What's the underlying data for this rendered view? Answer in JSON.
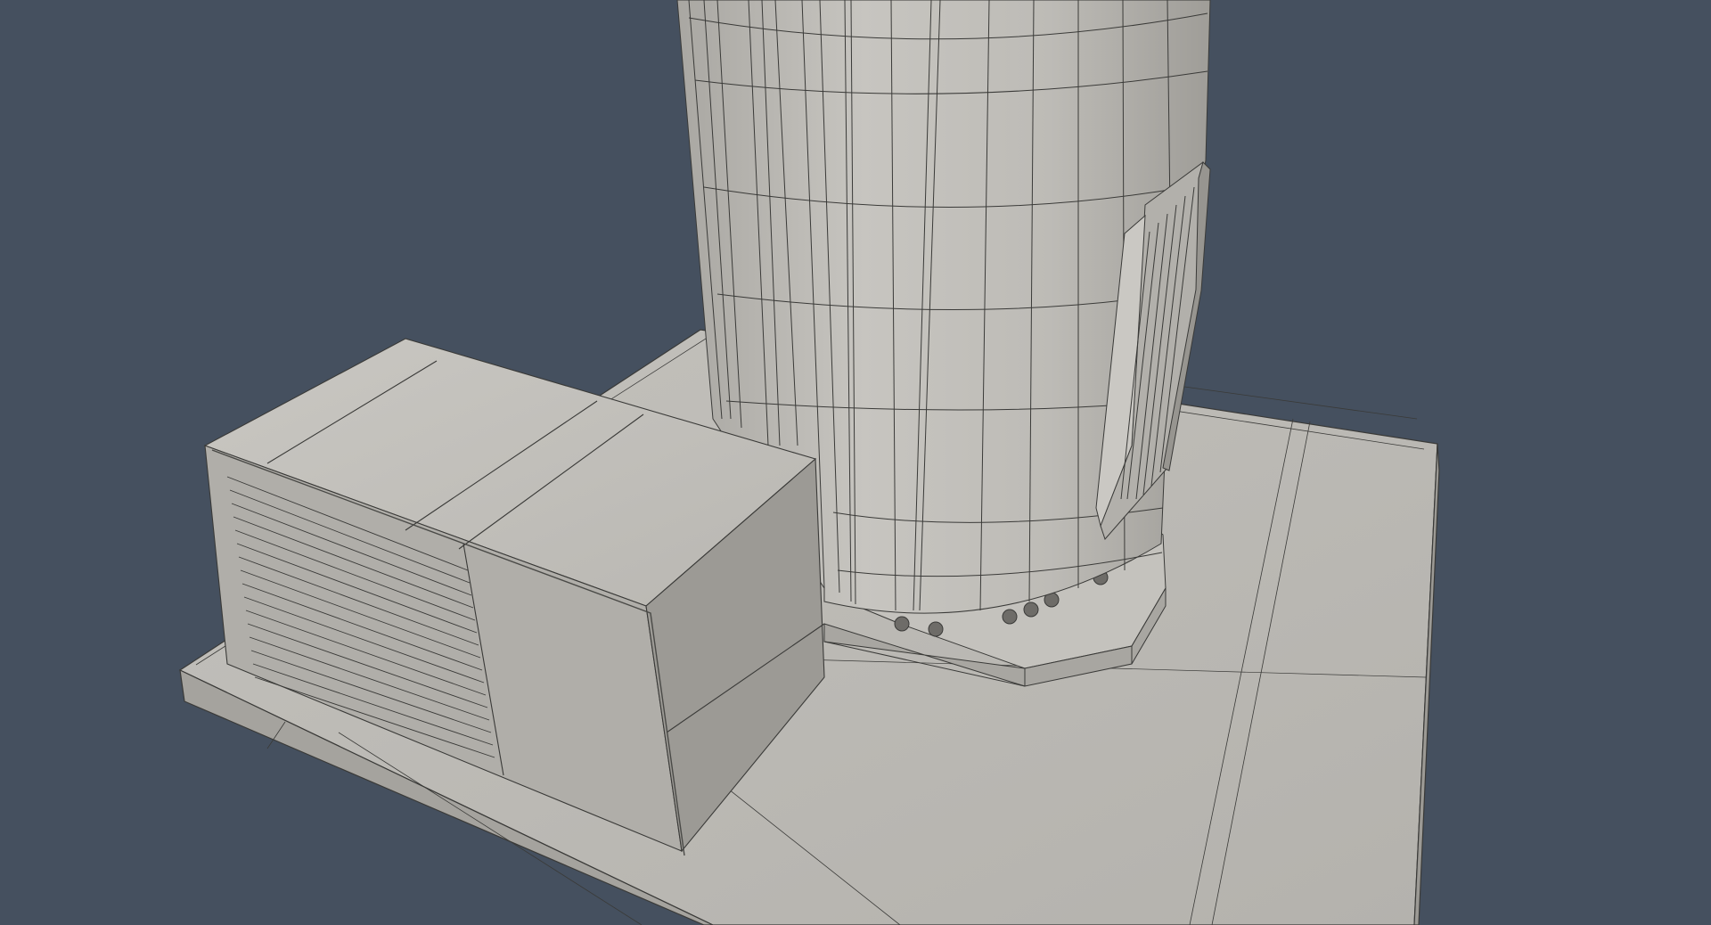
{
  "viewport": {
    "background": "#45505f",
    "mesh_fill": "#bdbbb6",
    "mesh_light": "#cfcdc8",
    "mesh_shadow": "#8f8d87",
    "wire_color": "#3a3a38"
  },
  "scene": {
    "objects": [
      "concrete-slab",
      "outdoor-ac-unit",
      "cylindrical-tank",
      "tank-base-flange",
      "tank-side-access-hatch"
    ]
  }
}
